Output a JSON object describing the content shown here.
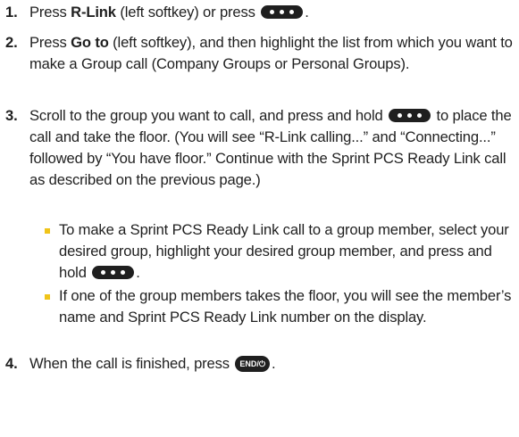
{
  "steps": [
    {
      "number": "1.",
      "parts": [
        "Press ",
        "R-Link",
        " (left softkey) or press ",
        "."
      ]
    },
    {
      "number": "2.",
      "parts": [
        "Press ",
        "Go to",
        " (left softkey), and then highlight the list from which you want to make a Group call (Company Groups or Personal Groups)."
      ]
    },
    {
      "number": "3.",
      "parts": [
        "Scroll to the group you want to call, and press and hold ",
        " to place the call and take the floor. (You will see “R-Link calling...” and “Connecting...” followed by “You have floor.” Continue with the Sprint PCS Ready Link call as described on the previous page.)"
      ]
    },
    {
      "number": "4.",
      "parts": [
        "When the call is finished, press ",
        "."
      ]
    }
  ],
  "bullets": [
    {
      "parts": [
        "To make a Sprint PCS Ready Link call to a group member, select your desired group, highlight your desired group member, and press and hold ",
        "."
      ]
    },
    {
      "text": "If one of the group members takes the floor, you will see the member’s name and Sprint PCS Ready Link number on the display."
    }
  ],
  "keys": {
    "end_key": "END/⏻"
  },
  "colors": {
    "text": "#1f1f1f",
    "bullet": "#f0c419",
    "key_fill": "#1f1f1f"
  },
  "icons": {
    "talk_key": "ready-link-key-icon",
    "end_key": "end-power-key-icon"
  }
}
